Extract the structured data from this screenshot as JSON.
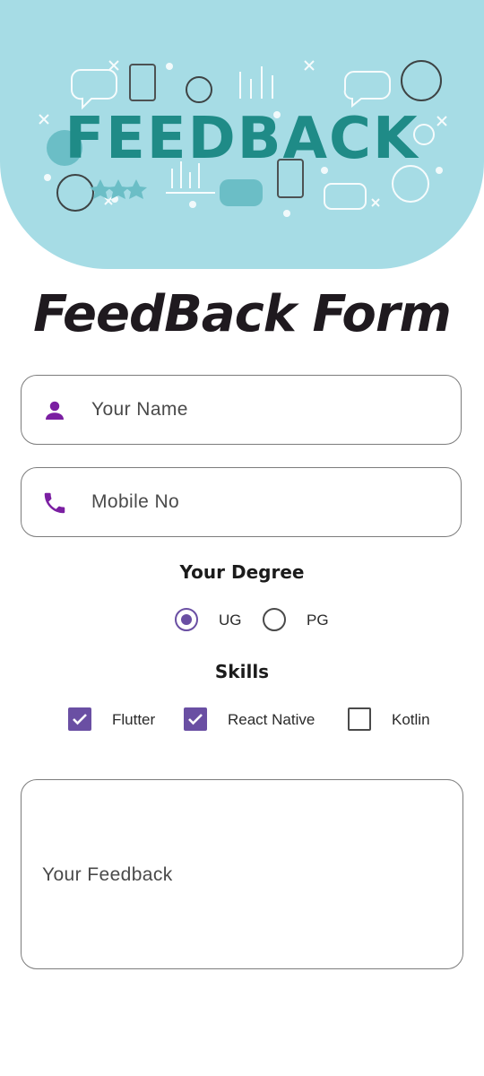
{
  "banner": {
    "word": "FEEDBACK",
    "background": "#a6dce5",
    "accent": "#1f8b87"
  },
  "form": {
    "title": "FeedBack Form",
    "name_field": {
      "placeholder": "Your Name",
      "icon": "person-icon"
    },
    "mobile_field": {
      "placeholder": "Mobile No",
      "icon": "phone-icon"
    },
    "degree": {
      "label": "Your Degree",
      "options": [
        {
          "label": "UG",
          "selected": true
        },
        {
          "label": "PG",
          "selected": false
        }
      ]
    },
    "skills": {
      "label": "Skills",
      "options": [
        {
          "label": "Flutter",
          "checked": true
        },
        {
          "label": "React Native",
          "checked": true
        },
        {
          "label": "Kotlin",
          "checked": false
        }
      ]
    },
    "feedback_field": {
      "placeholder": "Your Feedback"
    }
  },
  "colors": {
    "primary": "#6a4fa3",
    "icon": "#7b1fa2",
    "border": "#7c7c7c"
  }
}
